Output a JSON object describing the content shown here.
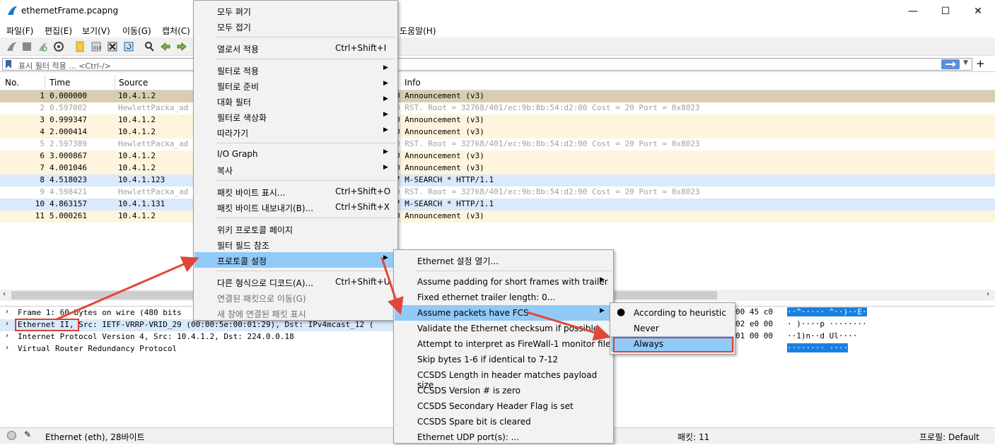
{
  "window": {
    "title": "ethernetFrame.pcapng",
    "min": "—",
    "max": "☐",
    "close": "✕"
  },
  "menubar": {
    "items": [
      "파일(F)",
      "편집(E)",
      "보기(V)",
      "이동(G)",
      "캡처(C)",
      "도움말(H)"
    ]
  },
  "filter": {
    "placeholder": "표시 필터 적용 ... <Ctrl-/>"
  },
  "columns": {
    "no": "No.",
    "time": "Time",
    "source": "Source",
    "info": "Info"
  },
  "packets": [
    {
      "no": "1",
      "time": "0.000000",
      "src": "10.4.1.2",
      "info": "0 Announcement (v3)",
      "style": "sel"
    },
    {
      "no": "2",
      "time": "0.597002",
      "src": "HewlettPacka_ad",
      "info": "0 RST. Root = 32768/401/ec:9b:8b:54:d2:00  Cost = 20  Port = 0x8023",
      "style": "stp"
    },
    {
      "no": "3",
      "time": "0.999347",
      "src": "10.4.1.2",
      "info": "0 Announcement (v3)",
      "style": "vrrp"
    },
    {
      "no": "4",
      "time": "2.000414",
      "src": "10.4.1.2",
      "info": "0 Announcement (v3)",
      "style": "vrrp"
    },
    {
      "no": "5",
      "time": "2.597389",
      "src": "HewlettPacka_ad",
      "info": "0 RST. Root = 32768/401/ec:9b:8b:54:d2:00  Cost = 20  Port = 0x8023",
      "style": "stp"
    },
    {
      "no": "6",
      "time": "3.000867",
      "src": "10.4.1.2",
      "info": "0 Announcement (v3)",
      "style": "vrrp"
    },
    {
      "no": "7",
      "time": "4.001046",
      "src": "10.4.1.2",
      "info": "0 Announcement (v3)",
      "style": "vrrp"
    },
    {
      "no": "8",
      "time": "4.518023",
      "src": "10.4.1.123",
      "info": "7 M-SEARCH * HTTP/1.1",
      "style": "ssdp"
    },
    {
      "no": "9",
      "time": "4.598421",
      "src": "HewlettPacka_ad",
      "info": "0 RST. Root = 32768/401/ec:9b:8b:54:d2:00  Cost = 20  Port = 0x8023",
      "style": "stp"
    },
    {
      "no": "10",
      "time": "4.863157",
      "src": "10.4.1.131",
      "info": "7 M-SEARCH * HTTP/1.1",
      "style": "ssdp"
    },
    {
      "no": "11",
      "time": "5.000261",
      "src": "10.4.1.2",
      "info": "0 Announcement (v3)",
      "style": "vrrp"
    }
  ],
  "details": [
    "Frame 1: 60 bytes on wire (480 bits",
    "Ethernet II, Src: IETF-VRRP-VRID_29 (00:00:5e:00:01:29), Dst: IPv4mcast_12 (",
    "Internet Protocol Version 4, Src: 10.4.1.2, Dst: 224.0.0.18",
    "Virtual Router Redundancy Protocol"
  ],
  "hex": {
    "line1": "00 45 c0",
    "line2": "02 e0 00",
    "line3": "01 00 00",
    "ascii1": "··^····· ^··)··E·",
    "ascii2": "· )····p ········",
    "ascii3": "··1)n··d Ul····",
    "ascii4": "········ ····"
  },
  "status": {
    "left": "Ethernet (eth), 28바이트",
    "packets": "패킷: 11",
    "profile": "프로필: Default"
  },
  "menu1": {
    "expand": "모두 펴기",
    "collapse": "모두 접기",
    "apply_col": "열로서 적용",
    "apply_col_sc": "Ctrl+Shift+I",
    "apply_filter": "필터로 적용",
    "prep_filter": "필터로 준비",
    "conv_filter": "대화 필터",
    "colorize": "필터로 색상화",
    "follow": "따라가기",
    "io_graph": "I/O Graph",
    "copy": "복사",
    "show_bytes": "패킷 바이트 표시...",
    "show_bytes_sc": "Ctrl+Shift+O",
    "export_bytes": "패킷 바이트 내보내기(B)...",
    "export_bytes_sc": "Ctrl+Shift+X",
    "wiki": "위키 프로토콜 페이지",
    "field_ref": "필터 필드 참조",
    "proto_pref": "프로토콜 설정",
    "decode_as": "다른 형식으로 디코드(A)...",
    "decode_as_sc": "Ctrl+Shift+U",
    "go_linked": "연결된 패킷으로 이동(G)",
    "show_linked": "새 창에 연결된 패킷 표시"
  },
  "menu2": {
    "open_eth": "Ethernet 설정 열기...",
    "padding": "Assume padding for short frames with trailer",
    "trailer_len": "Fixed ethernet trailer length: 0...",
    "fcs": "Assume packets have FCS",
    "validate": "Validate the Ethernet checksum if possible",
    "firewall": "Attempt to interpret as FireWall-1 monitor file",
    "skip": "Skip bytes 1-6 if identical to 7-12",
    "ccsds_len": "CCSDS Length in header matches payload size",
    "ccsds_ver": "CCSDS Version # is zero",
    "ccsds_sec": "CCSDS Secondary Header Flag is set",
    "ccsds_spare": "CCSDS Spare bit is cleared",
    "udp_port": "Ethernet UDP port(s): ..."
  },
  "menu3": {
    "heuristic": "According to heuristic",
    "never": "Never",
    "always": "Always"
  },
  "colors": {
    "selected": "#d9ccb0",
    "vrrp": "#fff4dd",
    "ssdp": "#dae9fb",
    "highlight": "#91c9f7",
    "arrow": "#e0473a"
  }
}
